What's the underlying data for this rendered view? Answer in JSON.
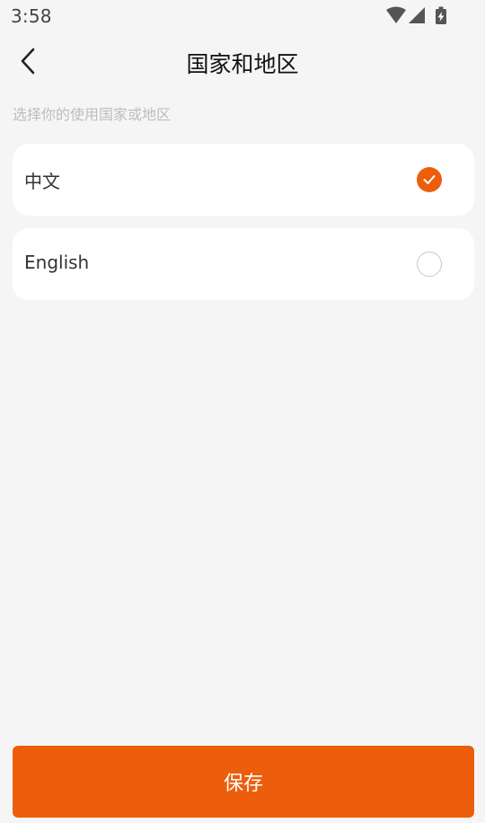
{
  "status_bar": {
    "time": "3:58",
    "icons": [
      "wifi-icon",
      "cell-signal-icon",
      "battery-charging-icon"
    ]
  },
  "header": {
    "title": "国家和地区",
    "back_icon": "chevron-left-icon"
  },
  "hint": "选择你的使用国家或地区",
  "options": [
    {
      "label": "中文",
      "selected": true
    },
    {
      "label": "English",
      "selected": false
    }
  ],
  "save_label": "保存",
  "colors": {
    "accent": "#ec5e0b",
    "background": "#f5f5f5",
    "card": "#ffffff"
  }
}
